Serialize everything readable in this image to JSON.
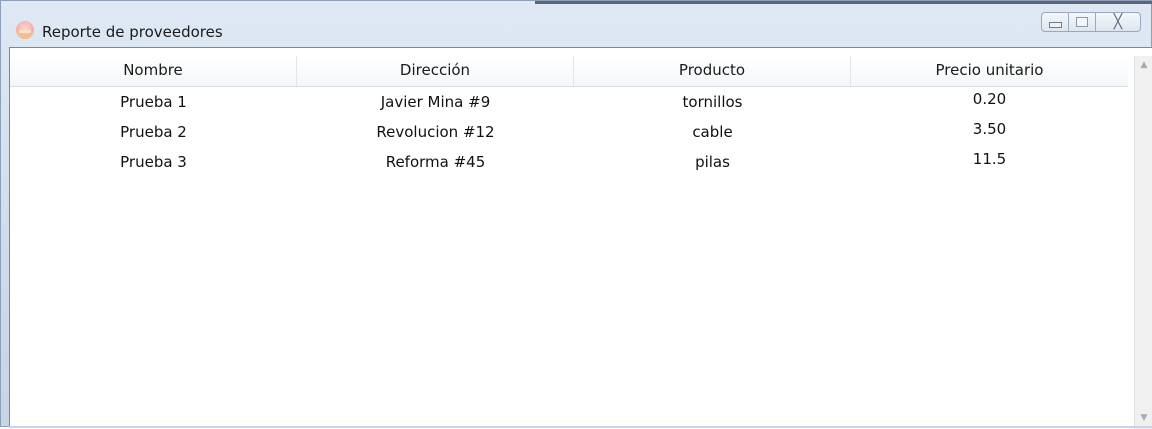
{
  "window": {
    "title": "Reporte de proveedores",
    "icon": "cake-icon",
    "buttons": {
      "minimize": "minimize-icon",
      "maximize": "maximize-icon",
      "close_glyph": "╳"
    }
  },
  "table": {
    "columns": [
      "Nombre",
      "Dirección",
      "Producto",
      "Precio unitario"
    ],
    "rows": [
      [
        "Prueba 1",
        "Javier Mina #9",
        "tornillos",
        "0.20"
      ],
      [
        "Prueba 2",
        "Revolucion #12",
        "cable",
        "3.50"
      ],
      [
        "Prueba 3",
        "Reforma #45",
        "pilas",
        "11.5"
      ]
    ]
  },
  "scrollbar": {
    "up_arrow": "▲",
    "down_arrow": "▼"
  }
}
